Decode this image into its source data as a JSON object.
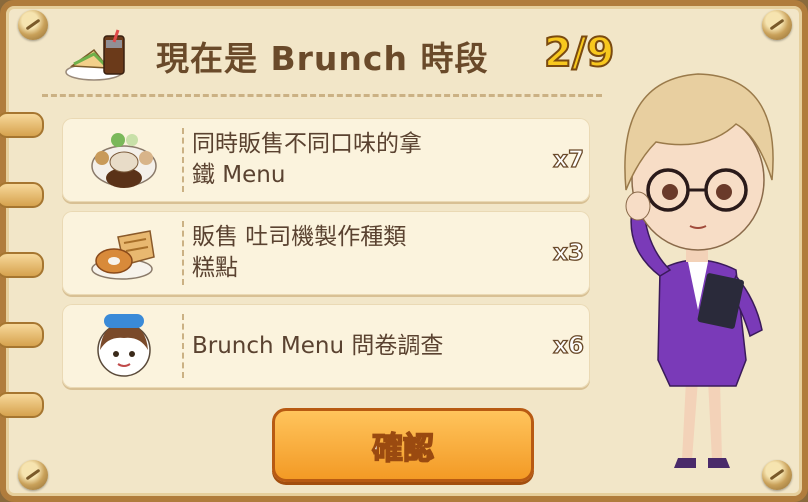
{
  "header": {
    "title": "現在是 Brunch 時段",
    "progress": "2/9"
  },
  "tasks": [
    {
      "label_line1": "同時販售不同口味的拿",
      "label_line2": "鐵 Menu",
      "count": "x7",
      "icon": "latte-menu-icon"
    },
    {
      "label_line1": "販售 吐司機製作種類",
      "label_line2": "糕點",
      "count": "x3",
      "icon": "toast-pastry-icon"
    },
    {
      "label_line1": "Brunch Menu 問卷調查",
      "label_line2": "",
      "count": "x6",
      "icon": "hello-girl-icon"
    }
  ],
  "confirm_label": "確認",
  "colors": {
    "accent_orange": "#f39a25",
    "progress_yellow": "#f8c81e",
    "board": "#f2e6c8"
  }
}
